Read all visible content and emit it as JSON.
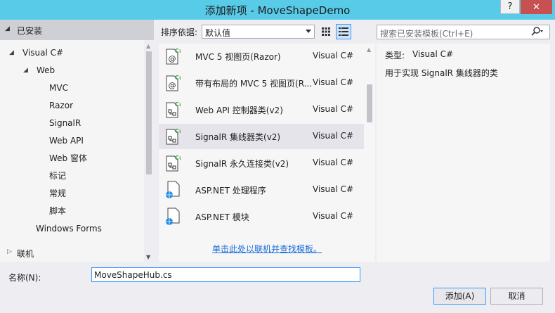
{
  "window": {
    "title": "添加新项 - MoveShapeDemo",
    "help_label": "?",
    "close_label": "✕"
  },
  "left_panel": {
    "installed_label": "已安装",
    "tree": [
      {
        "label": "Visual C#",
        "level": 0,
        "expanded": true
      },
      {
        "label": "Web",
        "level": 1,
        "expanded": true,
        "selected": true
      },
      {
        "label": "MVC",
        "level": 2
      },
      {
        "label": "Razor",
        "level": 2
      },
      {
        "label": "SignalR",
        "level": 2
      },
      {
        "label": "Web API",
        "level": 2
      },
      {
        "label": "Web 窗体",
        "level": 2
      },
      {
        "label": "标记",
        "level": 2
      },
      {
        "label": "常规",
        "level": 2
      },
      {
        "label": "脚本",
        "level": 2
      },
      {
        "label": "Windows Forms",
        "level": 1
      }
    ],
    "online_label": "联机"
  },
  "toolbar": {
    "sort_label": "排序依据:",
    "sort_value": "默认值"
  },
  "templates": [
    {
      "name": "MVC 5 视图页(Razor)",
      "lang": "Visual C#",
      "icon": "razor-page-icon"
    },
    {
      "name": "带有布局的 MVC 5 视图页(R...",
      "lang": "Visual C#",
      "icon": "razor-page-icon"
    },
    {
      "name": "Web API 控制器类(v2)",
      "lang": "Visual C#",
      "icon": "class-icon"
    },
    {
      "name": "SignalR 集线器类(v2)",
      "lang": "Visual C#",
      "icon": "class-icon",
      "selected": true
    },
    {
      "name": "SignalR 永久连接类(v2)",
      "lang": "Visual C#",
      "icon": "class-icon"
    },
    {
      "name": "ASP.NET 处理程序",
      "lang": "Visual C#",
      "icon": "web-file-icon"
    },
    {
      "name": "ASP.NET 模块",
      "lang": "Visual C#",
      "icon": "web-file-icon"
    }
  ],
  "online_link": "单击此处以联机并查找模板。",
  "search": {
    "placeholder": "搜索已安装模板(Ctrl+E)"
  },
  "details": {
    "type_label": "类型:",
    "type_value": "Visual C#",
    "description": "用于实现 SignalR 集线器的类"
  },
  "bottom": {
    "name_label": "名称(N):",
    "name_value": "MoveShapeHub.cs",
    "add_label": "添加(A)",
    "cancel_label": "取消"
  },
  "colors": {
    "title_bar": "#58cbe9",
    "close_button": "#c75050",
    "link": "#1a6ed8",
    "selection": "#cfcfd6",
    "csharp_badge": "#2e9e3a"
  }
}
